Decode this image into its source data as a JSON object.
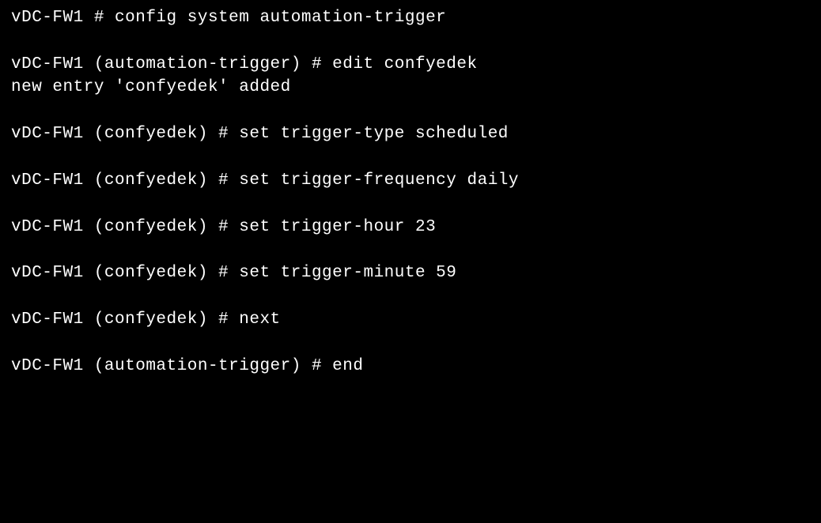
{
  "terminal": {
    "lines": [
      "vDC-FW1 # config system automation-trigger",
      "",
      "vDC-FW1 (automation-trigger) # edit confyedek",
      "new entry 'confyedek' added",
      "",
      "vDC-FW1 (confyedek) # set trigger-type scheduled",
      "",
      "vDC-FW1 (confyedek) # set trigger-frequency daily",
      "",
      "vDC-FW1 (confyedek) # set trigger-hour 23",
      "",
      "vDC-FW1 (confyedek) # set trigger-minute 59",
      "",
      "vDC-FW1 (confyedek) # next",
      "",
      "vDC-FW1 (automation-trigger) # end"
    ]
  }
}
